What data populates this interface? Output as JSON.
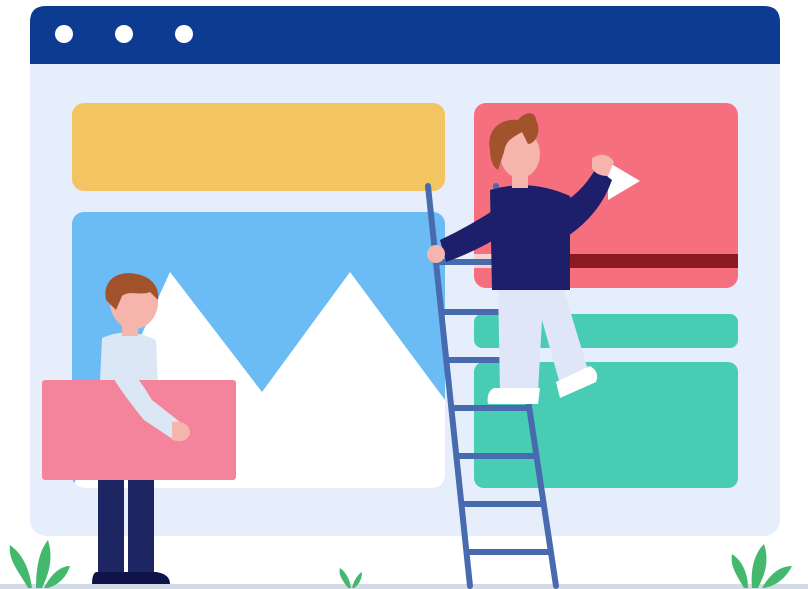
{
  "window": {
    "title_dots": 3
  },
  "colors": {
    "titlebar": "#0d3b91",
    "window_body": "#e7eefb",
    "header_block": "#f3c562",
    "image_block": "#6bbbf5",
    "mountain": "#ffffff",
    "video_block": "#f56f7f",
    "progress_track": "#8d1a23",
    "progress_played": "#f3d2cf",
    "green_block": "#48cdb4",
    "held_card": "#f4839c",
    "skin": "#f5b5ad",
    "hair": "#a3532b",
    "shirt_dark": "#1d1f6a",
    "pants_light": "#dfe6f8",
    "shirt_light": "#dbe7f5",
    "pants_dark": "#1d2563",
    "ladder": "#486bb0",
    "plant": "#44b96e",
    "ground": "#d4dbe8"
  },
  "video_player": {
    "progress": 0.28
  },
  "icons": {
    "play": "play-icon",
    "window_controls": "window-dot-icon"
  }
}
